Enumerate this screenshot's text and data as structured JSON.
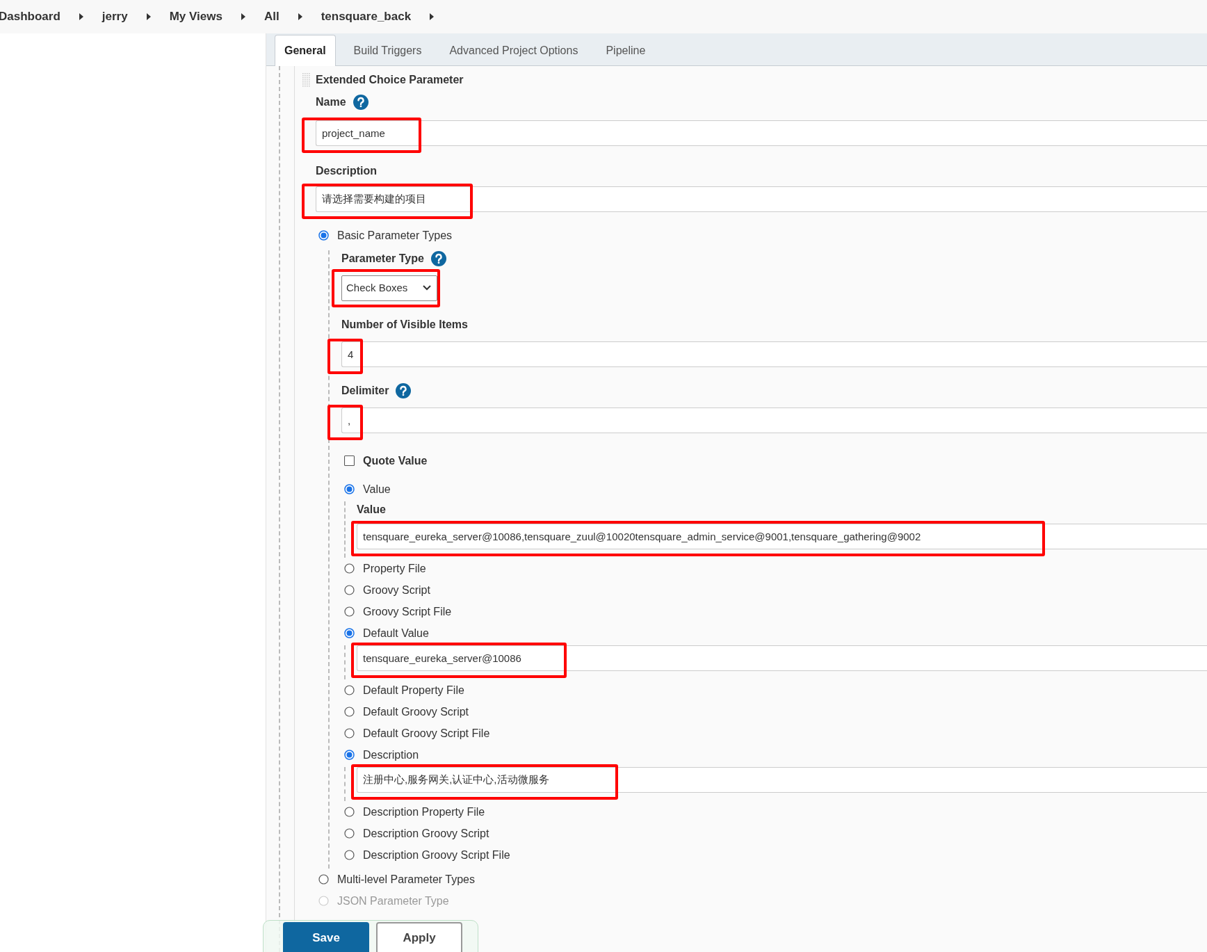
{
  "breadcrumb": [
    {
      "label": "Dashboard"
    },
    {
      "label": "jerry"
    },
    {
      "label": "My Views"
    },
    {
      "label": "All"
    },
    {
      "label": "tensquare_back"
    }
  ],
  "tabs": [
    {
      "label": "General",
      "selected": true
    },
    {
      "label": "Build Triggers",
      "selected": false
    },
    {
      "label": "Advanced Project Options",
      "selected": false
    },
    {
      "label": "Pipeline",
      "selected": false
    }
  ],
  "parameter": {
    "title": "Extended Choice Parameter",
    "fields": [
      {
        "label": "Name",
        "help": true,
        "value": "project_name",
        "highlighted": true
      },
      {
        "label": "Description",
        "help": false,
        "value": "请选择需要构建的项目",
        "highlighted": true
      }
    ],
    "types": [
      {
        "label": "Basic Parameter Types",
        "selected": true,
        "disabled": false,
        "settings": [
          {
            "kind": "select",
            "label": "Parameter Type",
            "help": true,
            "value": "Check Boxes",
            "highlighted": true
          },
          {
            "kind": "text",
            "label": "Number of Visible Items",
            "help": false,
            "value": "4",
            "highlighted": true
          },
          {
            "kind": "text",
            "label": "Delimiter",
            "help": true,
            "value": ",",
            "highlighted": true
          },
          {
            "kind": "checkbox",
            "label": "Quote Value",
            "checked": false
          },
          {
            "kind": "radio",
            "label": "Value",
            "selected": true,
            "field": {
              "label": "Value",
              "value": "tensquare_eureka_server@10086,tensquare_zuul@10020tensquare_admin_service@9001,tensquare_gathering@9002",
              "highlighted": true
            }
          },
          {
            "kind": "radio",
            "label": "Property File",
            "selected": false
          },
          {
            "kind": "radio",
            "label": "Groovy Script",
            "selected": false
          },
          {
            "kind": "radio",
            "label": "Groovy Script File",
            "selected": false
          },
          {
            "kind": "radio",
            "label": "Default Value",
            "selected": true,
            "field": {
              "value": "tensquare_eureka_server@10086",
              "highlighted": true
            }
          },
          {
            "kind": "radio",
            "label": "Default Property File",
            "selected": false
          },
          {
            "kind": "radio",
            "label": "Default Groovy Script",
            "selected": false
          },
          {
            "kind": "radio",
            "label": "Default Groovy Script File",
            "selected": false
          },
          {
            "kind": "radio",
            "label": "Description",
            "selected": true,
            "field": {
              "value": "注册中心,服务网关,认证中心,活动微服务",
              "highlighted": true
            }
          },
          {
            "kind": "radio",
            "label": "Description Property File",
            "selected": false
          },
          {
            "kind": "radio",
            "label": "Description Groovy Script",
            "selected": false
          },
          {
            "kind": "radio",
            "label": "Description Groovy Script File",
            "selected": false
          }
        ]
      },
      {
        "label": "Multi-level Parameter Types",
        "selected": false,
        "disabled": false
      },
      {
        "label": "JSON Parameter Type",
        "selected": false,
        "disabled": true
      }
    ]
  },
  "buttons": [
    {
      "label": "Save",
      "kind": "primary"
    },
    {
      "label": "Apply",
      "kind": "secondary"
    }
  ]
}
